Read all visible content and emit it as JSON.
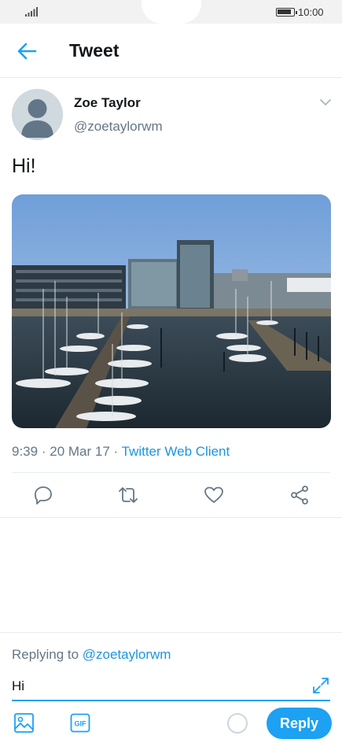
{
  "status_bar": {
    "time": "10:00"
  },
  "header": {
    "title": "Tweet"
  },
  "tweet": {
    "author_name": "Zoe Taylor",
    "author_handle": "@zoetaylorwm",
    "text": "Hi!",
    "time": "9:39",
    "date": "20 Mar 17",
    "separator": "·",
    "client": "Twitter Web Client"
  },
  "composer": {
    "replying_prefix": "Replying to",
    "replying_handle": "@zoetaylorwm",
    "input_value": "Hi",
    "reply_label": "Reply",
    "gif_label": "GIF"
  },
  "colors": {
    "accent": "#1da1f2",
    "link": "#1b95e0",
    "secondary_text": "#657786"
  },
  "icons": [
    "back-arrow-icon",
    "chevron-down-icon",
    "reply-icon",
    "retweet-icon",
    "heart-icon",
    "share-icon",
    "expand-icon",
    "image-icon",
    "gif-icon"
  ]
}
